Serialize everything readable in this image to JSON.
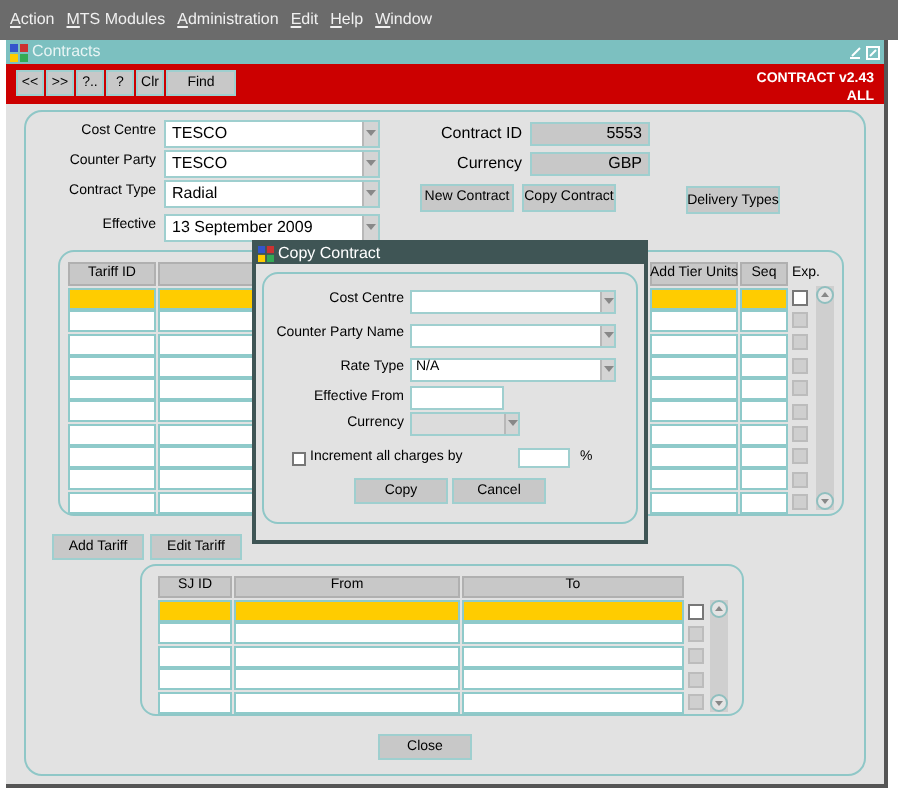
{
  "menu": [
    "Action",
    "MTS Modules",
    "Administration",
    "Edit",
    "Help",
    "Window"
  ],
  "window": {
    "title": "Contracts"
  },
  "toolbar": {
    "buttons": [
      "<<",
      ">>",
      "?..",
      "?",
      "Clr",
      "Find"
    ],
    "app_title": "CONTRACT v2.43",
    "scope": "ALL"
  },
  "form": {
    "fields": [
      {
        "label": "Cost Centre",
        "value": "TESCO"
      },
      {
        "label": "Counter Party",
        "value": "TESCO"
      },
      {
        "label": "Contract Type",
        "value": "Radial"
      },
      {
        "label": "Effective",
        "value": "13 September 2009"
      }
    ],
    "info": [
      {
        "label": "Contract ID",
        "value": "5553"
      },
      {
        "label": "Currency",
        "value": "GBP"
      }
    ],
    "buttons": [
      "New Contract",
      "Copy Contract"
    ],
    "delivery_button": "Delivery Types"
  },
  "tariff_table": {
    "columns": [
      "Tariff ID",
      "Add Tier Units",
      "Seq"
    ],
    "exp_label": "Exp.",
    "rows": [
      {
        "selected": true,
        "exp_disabled": false
      },
      {
        "selected": false,
        "exp_disabled": true
      },
      {
        "selected": false,
        "exp_disabled": true
      },
      {
        "selected": false,
        "exp_disabled": true
      },
      {
        "selected": false,
        "exp_disabled": true
      },
      {
        "selected": false,
        "exp_disabled": true
      },
      {
        "selected": false,
        "exp_disabled": true
      },
      {
        "selected": false,
        "exp_disabled": true
      },
      {
        "selected": false,
        "exp_disabled": true
      },
      {
        "selected": false,
        "exp_disabled": true
      }
    ]
  },
  "tariff_buttons": [
    "Add Tariff",
    "Edit Tariff"
  ],
  "sj_table": {
    "columns": [
      "SJ ID",
      "From",
      "To"
    ],
    "rows": [
      {
        "selected": true,
        "exp_disabled": false
      },
      {
        "selected": false,
        "exp_disabled": true
      },
      {
        "selected": false,
        "exp_disabled": true
      },
      {
        "selected": false,
        "exp_disabled": true
      },
      {
        "selected": false,
        "exp_disabled": true
      }
    ]
  },
  "close_button": "Close",
  "dialog": {
    "title": "Copy Contract",
    "fields": [
      {
        "label": "Cost Centre",
        "kind": "dropdown",
        "disabled": false
      },
      {
        "label": "Counter Party Name",
        "kind": "dropdown",
        "disabled": false
      },
      {
        "label": "Rate Type",
        "kind": "dropdown",
        "value": "N/A",
        "disabled": false
      },
      {
        "label": "Effective From",
        "kind": "text",
        "disabled": false
      },
      {
        "label": "Currency",
        "kind": "dropdown",
        "disabled": true
      }
    ],
    "increment": {
      "checked": false,
      "label": "Increment all charges by",
      "suffix": "%"
    },
    "buttons": [
      "Copy",
      "Cancel"
    ]
  }
}
